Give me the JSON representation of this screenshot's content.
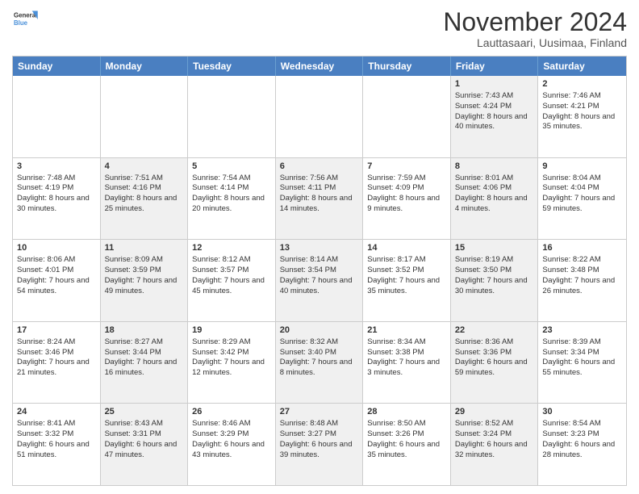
{
  "logo": {
    "line1": "General",
    "line2": "Blue"
  },
  "title": "November 2024",
  "subtitle": "Lauttasaari, Uusimaa, Finland",
  "header_days": [
    "Sunday",
    "Monday",
    "Tuesday",
    "Wednesday",
    "Thursday",
    "Friday",
    "Saturday"
  ],
  "rows": [
    [
      {
        "day": "",
        "info": "",
        "shaded": false
      },
      {
        "day": "",
        "info": "",
        "shaded": false
      },
      {
        "day": "",
        "info": "",
        "shaded": false
      },
      {
        "day": "",
        "info": "",
        "shaded": false
      },
      {
        "day": "",
        "info": "",
        "shaded": false
      },
      {
        "day": "1",
        "info": "Sunrise: 7:43 AM\nSunset: 4:24 PM\nDaylight: 8 hours and 40 minutes.",
        "shaded": true
      },
      {
        "day": "2",
        "info": "Sunrise: 7:46 AM\nSunset: 4:21 PM\nDaylight: 8 hours and 35 minutes.",
        "shaded": false
      }
    ],
    [
      {
        "day": "3",
        "info": "Sunrise: 7:48 AM\nSunset: 4:19 PM\nDaylight: 8 hours and 30 minutes.",
        "shaded": false
      },
      {
        "day": "4",
        "info": "Sunrise: 7:51 AM\nSunset: 4:16 PM\nDaylight: 8 hours and 25 minutes.",
        "shaded": true
      },
      {
        "day": "5",
        "info": "Sunrise: 7:54 AM\nSunset: 4:14 PM\nDaylight: 8 hours and 20 minutes.",
        "shaded": false
      },
      {
        "day": "6",
        "info": "Sunrise: 7:56 AM\nSunset: 4:11 PM\nDaylight: 8 hours and 14 minutes.",
        "shaded": true
      },
      {
        "day": "7",
        "info": "Sunrise: 7:59 AM\nSunset: 4:09 PM\nDaylight: 8 hours and 9 minutes.",
        "shaded": false
      },
      {
        "day": "8",
        "info": "Sunrise: 8:01 AM\nSunset: 4:06 PM\nDaylight: 8 hours and 4 minutes.",
        "shaded": true
      },
      {
        "day": "9",
        "info": "Sunrise: 8:04 AM\nSunset: 4:04 PM\nDaylight: 7 hours and 59 minutes.",
        "shaded": false
      }
    ],
    [
      {
        "day": "10",
        "info": "Sunrise: 8:06 AM\nSunset: 4:01 PM\nDaylight: 7 hours and 54 minutes.",
        "shaded": false
      },
      {
        "day": "11",
        "info": "Sunrise: 8:09 AM\nSunset: 3:59 PM\nDaylight: 7 hours and 49 minutes.",
        "shaded": true
      },
      {
        "day": "12",
        "info": "Sunrise: 8:12 AM\nSunset: 3:57 PM\nDaylight: 7 hours and 45 minutes.",
        "shaded": false
      },
      {
        "day": "13",
        "info": "Sunrise: 8:14 AM\nSunset: 3:54 PM\nDaylight: 7 hours and 40 minutes.",
        "shaded": true
      },
      {
        "day": "14",
        "info": "Sunrise: 8:17 AM\nSunset: 3:52 PM\nDaylight: 7 hours and 35 minutes.",
        "shaded": false
      },
      {
        "day": "15",
        "info": "Sunrise: 8:19 AM\nSunset: 3:50 PM\nDaylight: 7 hours and 30 minutes.",
        "shaded": true
      },
      {
        "day": "16",
        "info": "Sunrise: 8:22 AM\nSunset: 3:48 PM\nDaylight: 7 hours and 26 minutes.",
        "shaded": false
      }
    ],
    [
      {
        "day": "17",
        "info": "Sunrise: 8:24 AM\nSunset: 3:46 PM\nDaylight: 7 hours and 21 minutes.",
        "shaded": false
      },
      {
        "day": "18",
        "info": "Sunrise: 8:27 AM\nSunset: 3:44 PM\nDaylight: 7 hours and 16 minutes.",
        "shaded": true
      },
      {
        "day": "19",
        "info": "Sunrise: 8:29 AM\nSunset: 3:42 PM\nDaylight: 7 hours and 12 minutes.",
        "shaded": false
      },
      {
        "day": "20",
        "info": "Sunrise: 8:32 AM\nSunset: 3:40 PM\nDaylight: 7 hours and 8 minutes.",
        "shaded": true
      },
      {
        "day": "21",
        "info": "Sunrise: 8:34 AM\nSunset: 3:38 PM\nDaylight: 7 hours and 3 minutes.",
        "shaded": false
      },
      {
        "day": "22",
        "info": "Sunrise: 8:36 AM\nSunset: 3:36 PM\nDaylight: 6 hours and 59 minutes.",
        "shaded": true
      },
      {
        "day": "23",
        "info": "Sunrise: 8:39 AM\nSunset: 3:34 PM\nDaylight: 6 hours and 55 minutes.",
        "shaded": false
      }
    ],
    [
      {
        "day": "24",
        "info": "Sunrise: 8:41 AM\nSunset: 3:32 PM\nDaylight: 6 hours and 51 minutes.",
        "shaded": false
      },
      {
        "day": "25",
        "info": "Sunrise: 8:43 AM\nSunset: 3:31 PM\nDaylight: 6 hours and 47 minutes.",
        "shaded": true
      },
      {
        "day": "26",
        "info": "Sunrise: 8:46 AM\nSunset: 3:29 PM\nDaylight: 6 hours and 43 minutes.",
        "shaded": false
      },
      {
        "day": "27",
        "info": "Sunrise: 8:48 AM\nSunset: 3:27 PM\nDaylight: 6 hours and 39 minutes.",
        "shaded": true
      },
      {
        "day": "28",
        "info": "Sunrise: 8:50 AM\nSunset: 3:26 PM\nDaylight: 6 hours and 35 minutes.",
        "shaded": false
      },
      {
        "day": "29",
        "info": "Sunrise: 8:52 AM\nSunset: 3:24 PM\nDaylight: 6 hours and 32 minutes.",
        "shaded": true
      },
      {
        "day": "30",
        "info": "Sunrise: 8:54 AM\nSunset: 3:23 PM\nDaylight: 6 hours and 28 minutes.",
        "shaded": false
      }
    ]
  ]
}
